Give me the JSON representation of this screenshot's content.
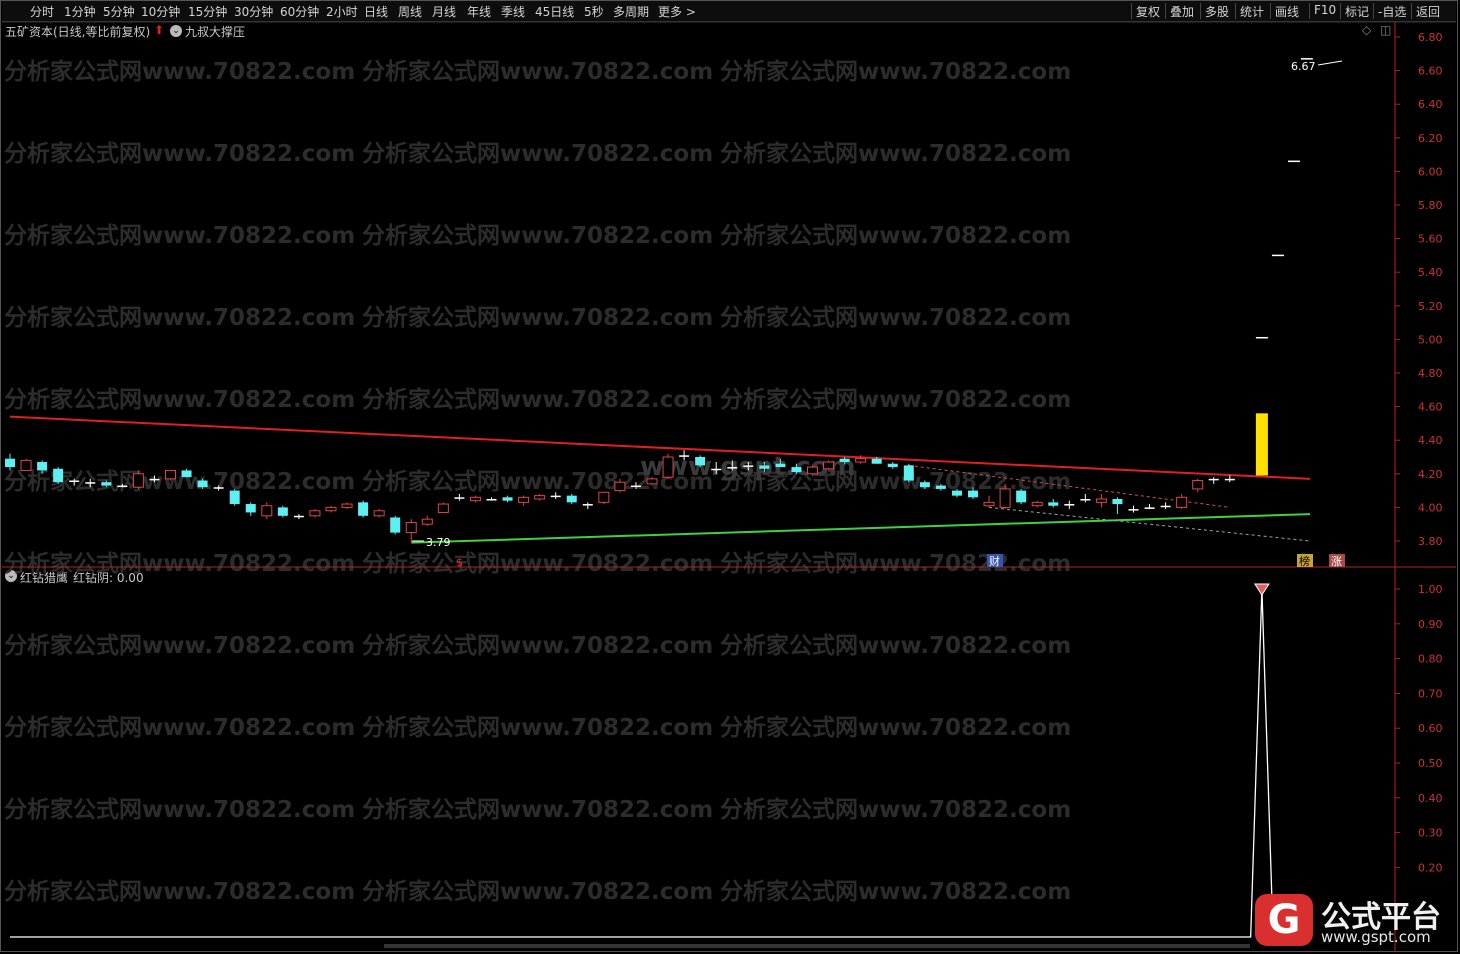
{
  "toolbar": {
    "periods": [
      "分时",
      "1分钟",
      "5分钟",
      "10分钟",
      "15分钟",
      "30分钟",
      "60分钟",
      "2小时",
      "日线",
      "周线",
      "月线",
      "年线",
      "季线",
      "45日线",
      "5秒",
      "多周期",
      "更多 >"
    ],
    "right_tools": [
      "复权",
      "叠加",
      "多股",
      "统计",
      "画线",
      "F10",
      "标记",
      "-自选",
      "返回"
    ]
  },
  "main_chart": {
    "stock_title": "五矿资本(日线,等比前复权)",
    "indicator_name": "九叔大撑压",
    "y_ticks": [
      "6.80",
      "6.60",
      "6.40",
      "6.20",
      "6.00",
      "5.80",
      "5.60",
      "5.40",
      "5.20",
      "5.00",
      "4.80",
      "4.60",
      "4.40",
      "4.20",
      "4.00",
      "3.80"
    ],
    "high_label": "6.67",
    "low_label": "3.79",
    "markers": {
      "s": "$",
      "cai": "财",
      "bang": "榜",
      "zhang": "涨"
    }
  },
  "sub_chart": {
    "indicator_name": "红钻猎鹰",
    "series_label": "红钻阴: 0.00",
    "y_ticks": [
      "1.00",
      "0.90",
      "0.80",
      "0.70",
      "0.60",
      "0.50",
      "0.40",
      "0.30",
      "0.20"
    ]
  },
  "watermark": {
    "text": "分析家公式网www.70822.com",
    "overlay": "www.gspt.com"
  },
  "logo": {
    "title": "公式平台",
    "url": "www.gspt.com"
  },
  "colors": {
    "up": "#e04545",
    "down": "#5ef0f0",
    "resistance": "#e02020",
    "support": "#40d040",
    "volume_bar": "#ffe000",
    "axis": "#b22222"
  },
  "chart_data": [
    {
      "type": "candlestick",
      "title": "五矿资本(日线,等比前复权)",
      "ylim": [
        3.7,
        6.85
      ],
      "candles": [
        {
          "o": 4.29,
          "h": 4.32,
          "l": 4.22,
          "c": 4.24
        },
        {
          "o": 4.22,
          "h": 4.29,
          "l": 4.22,
          "c": 4.28
        },
        {
          "o": 4.27,
          "h": 4.28,
          "l": 4.2,
          "c": 4.22
        },
        {
          "o": 4.23,
          "h": 4.24,
          "l": 4.14,
          "c": 4.15
        },
        {
          "o": 4.15,
          "h": 4.17,
          "l": 4.13,
          "c": 4.16
        },
        {
          "o": 4.14,
          "h": 4.17,
          "l": 4.12,
          "c": 4.15
        },
        {
          "o": 4.15,
          "h": 4.16,
          "l": 4.12,
          "c": 4.13
        },
        {
          "o": 4.13,
          "h": 4.14,
          "l": 4.12,
          "c": 4.13
        },
        {
          "o": 4.12,
          "h": 4.22,
          "l": 4.11,
          "c": 4.2
        },
        {
          "o": 4.17,
          "h": 4.19,
          "l": 4.15,
          "c": 4.17
        },
        {
          "o": 4.17,
          "h": 4.22,
          "l": 4.16,
          "c": 4.22
        },
        {
          "o": 4.22,
          "h": 4.23,
          "l": 4.18,
          "c": 4.18
        },
        {
          "o": 4.16,
          "h": 4.17,
          "l": 4.11,
          "c": 4.12
        },
        {
          "o": 4.11,
          "h": 4.13,
          "l": 4.1,
          "c": 4.12
        },
        {
          "o": 4.1,
          "h": 4.11,
          "l": 4.01,
          "c": 4.02
        },
        {
          "o": 4.02,
          "h": 4.03,
          "l": 3.95,
          "c": 3.97
        },
        {
          "o": 3.95,
          "h": 4.03,
          "l": 3.93,
          "c": 4.01
        },
        {
          "o": 4.0,
          "h": 4.01,
          "l": 3.94,
          "c": 3.95
        },
        {
          "o": 3.94,
          "h": 3.96,
          "l": 3.93,
          "c": 3.95
        },
        {
          "o": 3.95,
          "h": 3.99,
          "l": 3.94,
          "c": 3.98
        },
        {
          "o": 3.98,
          "h": 4.01,
          "l": 3.97,
          "c": 4.0
        },
        {
          "o": 4.0,
          "h": 4.03,
          "l": 3.99,
          "c": 4.02
        },
        {
          "o": 4.03,
          "h": 4.04,
          "l": 3.94,
          "c": 3.95
        },
        {
          "o": 3.95,
          "h": 3.99,
          "l": 3.94,
          "c": 3.98
        },
        {
          "o": 3.94,
          "h": 3.95,
          "l": 3.84,
          "c": 3.85
        },
        {
          "o": 3.85,
          "h": 3.93,
          "l": 3.79,
          "c": 3.91
        },
        {
          "o": 3.9,
          "h": 3.95,
          "l": 3.89,
          "c": 3.93
        },
        {
          "o": 3.97,
          "h": 4.03,
          "l": 3.97,
          "c": 4.02
        },
        {
          "o": 4.05,
          "h": 4.08,
          "l": 4.04,
          "c": 4.06
        },
        {
          "o": 4.04,
          "h": 4.07,
          "l": 4.03,
          "c": 4.06
        },
        {
          "o": 4.05,
          "h": 4.06,
          "l": 4.04,
          "c": 4.05
        },
        {
          "o": 4.06,
          "h": 4.07,
          "l": 4.03,
          "c": 4.04
        },
        {
          "o": 4.03,
          "h": 4.07,
          "l": 4.01,
          "c": 4.06
        },
        {
          "o": 4.05,
          "h": 4.08,
          "l": 4.04,
          "c": 4.07
        },
        {
          "o": 4.07,
          "h": 4.09,
          "l": 4.05,
          "c": 4.06
        },
        {
          "o": 4.07,
          "h": 4.08,
          "l": 4.02,
          "c": 4.03
        },
        {
          "o": 4.02,
          "h": 4.03,
          "l": 3.99,
          "c": 4.02
        },
        {
          "o": 4.03,
          "h": 4.09,
          "l": 4.02,
          "c": 4.09
        },
        {
          "o": 4.1,
          "h": 4.17,
          "l": 4.09,
          "c": 4.15
        },
        {
          "o": 4.13,
          "h": 4.15,
          "l": 4.11,
          "c": 4.13
        },
        {
          "o": 4.14,
          "h": 4.18,
          "l": 4.13,
          "c": 4.17
        },
        {
          "o": 4.18,
          "h": 4.32,
          "l": 4.17,
          "c": 4.3
        },
        {
          "o": 4.31,
          "h": 4.34,
          "l": 4.28,
          "c": 4.3
        },
        {
          "o": 4.3,
          "h": 4.31,
          "l": 4.24,
          "c": 4.25
        },
        {
          "o": 4.23,
          "h": 4.27,
          "l": 4.2,
          "c": 4.23
        },
        {
          "o": 4.24,
          "h": 4.28,
          "l": 4.22,
          "c": 4.24
        },
        {
          "o": 4.24,
          "h": 4.27,
          "l": 4.22,
          "c": 4.25
        },
        {
          "o": 4.25,
          "h": 4.27,
          "l": 4.21,
          "c": 4.23
        },
        {
          "o": 4.26,
          "h": 4.29,
          "l": 4.24,
          "c": 4.24
        },
        {
          "o": 4.24,
          "h": 4.26,
          "l": 4.2,
          "c": 4.21
        },
        {
          "o": 4.2,
          "h": 4.25,
          "l": 4.19,
          "c": 4.24
        },
        {
          "o": 4.23,
          "h": 4.28,
          "l": 4.22,
          "c": 4.27
        },
        {
          "o": 4.29,
          "h": 4.3,
          "l": 4.26,
          "c": 4.27
        },
        {
          "o": 4.27,
          "h": 4.31,
          "l": 4.26,
          "c": 4.29
        },
        {
          "o": 4.29,
          "h": 4.3,
          "l": 4.26,
          "c": 4.26
        },
        {
          "o": 4.26,
          "h": 4.27,
          "l": 4.23,
          "c": 4.24
        },
        {
          "o": 4.25,
          "h": 4.26,
          "l": 4.15,
          "c": 4.16
        },
        {
          "o": 4.15,
          "h": 4.16,
          "l": 4.11,
          "c": 4.12
        },
        {
          "o": 4.13,
          "h": 4.14,
          "l": 4.1,
          "c": 4.11
        },
        {
          "o": 4.1,
          "h": 4.11,
          "l": 4.06,
          "c": 4.07
        },
        {
          "o": 4.1,
          "h": 4.12,
          "l": 4.05,
          "c": 4.06
        },
        {
          "o": 4.01,
          "h": 4.07,
          "l": 4.0,
          "c": 4.03
        },
        {
          "o": 4.0,
          "h": 4.14,
          "l": 3.99,
          "c": 4.11
        },
        {
          "o": 4.1,
          "h": 4.11,
          "l": 4.02,
          "c": 4.03
        },
        {
          "o": 4.01,
          "h": 4.04,
          "l": 4.0,
          "c": 4.03
        },
        {
          "o": 4.03,
          "h": 4.05,
          "l": 4.0,
          "c": 4.01
        },
        {
          "o": 4.01,
          "h": 4.04,
          "l": 3.99,
          "c": 4.02
        },
        {
          "o": 4.04,
          "h": 4.08,
          "l": 4.03,
          "c": 4.05
        },
        {
          "o": 4.03,
          "h": 4.08,
          "l": 4.0,
          "c": 4.05
        },
        {
          "o": 4.05,
          "h": 4.06,
          "l": 3.96,
          "c": 4.02
        },
        {
          "o": 3.99,
          "h": 4.01,
          "l": 3.97,
          "c": 3.99
        },
        {
          "o": 4.0,
          "h": 4.02,
          "l": 3.99,
          "c": 4.0
        },
        {
          "o": 4.0,
          "h": 4.03,
          "l": 3.99,
          "c": 4.01
        },
        {
          "o": 4.0,
          "h": 4.08,
          "l": 3.99,
          "c": 4.06
        },
        {
          "o": 4.11,
          "h": 4.17,
          "l": 4.09,
          "c": 4.16
        },
        {
          "o": 4.16,
          "h": 4.18,
          "l": 4.14,
          "c": 4.17
        },
        {
          "o": 4.17,
          "h": 4.19,
          "l": 4.15,
          "c": 4.16
        }
      ],
      "resistance_line": [
        [
          0,
          4.54
        ],
        [
          81,
          4.17
        ]
      ],
      "support_line": [
        [
          25,
          3.79
        ],
        [
          81,
          3.96
        ]
      ],
      "dashed_upper": [
        [
          56,
          4.25
        ],
        [
          76,
          4.0
        ]
      ],
      "dashed_lower": [
        [
          61,
          4.0
        ],
        [
          81,
          3.8
        ]
      ],
      "volume_marker": {
        "index": 78,
        "from": 4.19,
        "to": 4.56
      },
      "target_ticks": [
        {
          "index": 78,
          "y": 5.01
        },
        {
          "index": 79,
          "y": 5.5
        },
        {
          "index": 80,
          "y": 6.06
        },
        {
          "index": 80.8,
          "y": 6.67
        }
      ]
    },
    {
      "type": "line",
      "title": "红钻猎鹰",
      "ylim": [
        0.0,
        1.05
      ],
      "series": [
        {
          "name": "红钻阴",
          "points": [
            [
              0,
              0
            ],
            [
              77.3,
              0
            ],
            [
              78,
              1.0
            ],
            [
              78.7,
              0
            ]
          ]
        }
      ],
      "peak_marker_index": 78
    }
  ]
}
